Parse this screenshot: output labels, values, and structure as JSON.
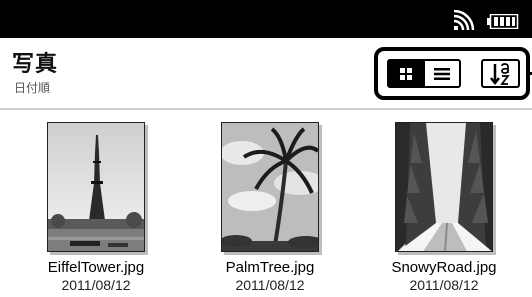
{
  "status_bar": {
    "icons": [
      "wifi-icon",
      "battery-icon"
    ]
  },
  "header": {
    "title": "写真",
    "subtitle": "日付順"
  },
  "toolbar": {
    "view_modes": [
      "grid-view-icon",
      "list-view-icon"
    ],
    "active_view": "grid",
    "sort_icon": "sort-alpha-icon"
  },
  "photos": [
    {
      "filename": "EiffelTower.jpg",
      "date": "2011/08/12"
    },
    {
      "filename": "PalmTree.jpg",
      "date": "2011/08/12"
    },
    {
      "filename": "SnowyRoad.jpg",
      "date": "2011/08/12"
    }
  ]
}
